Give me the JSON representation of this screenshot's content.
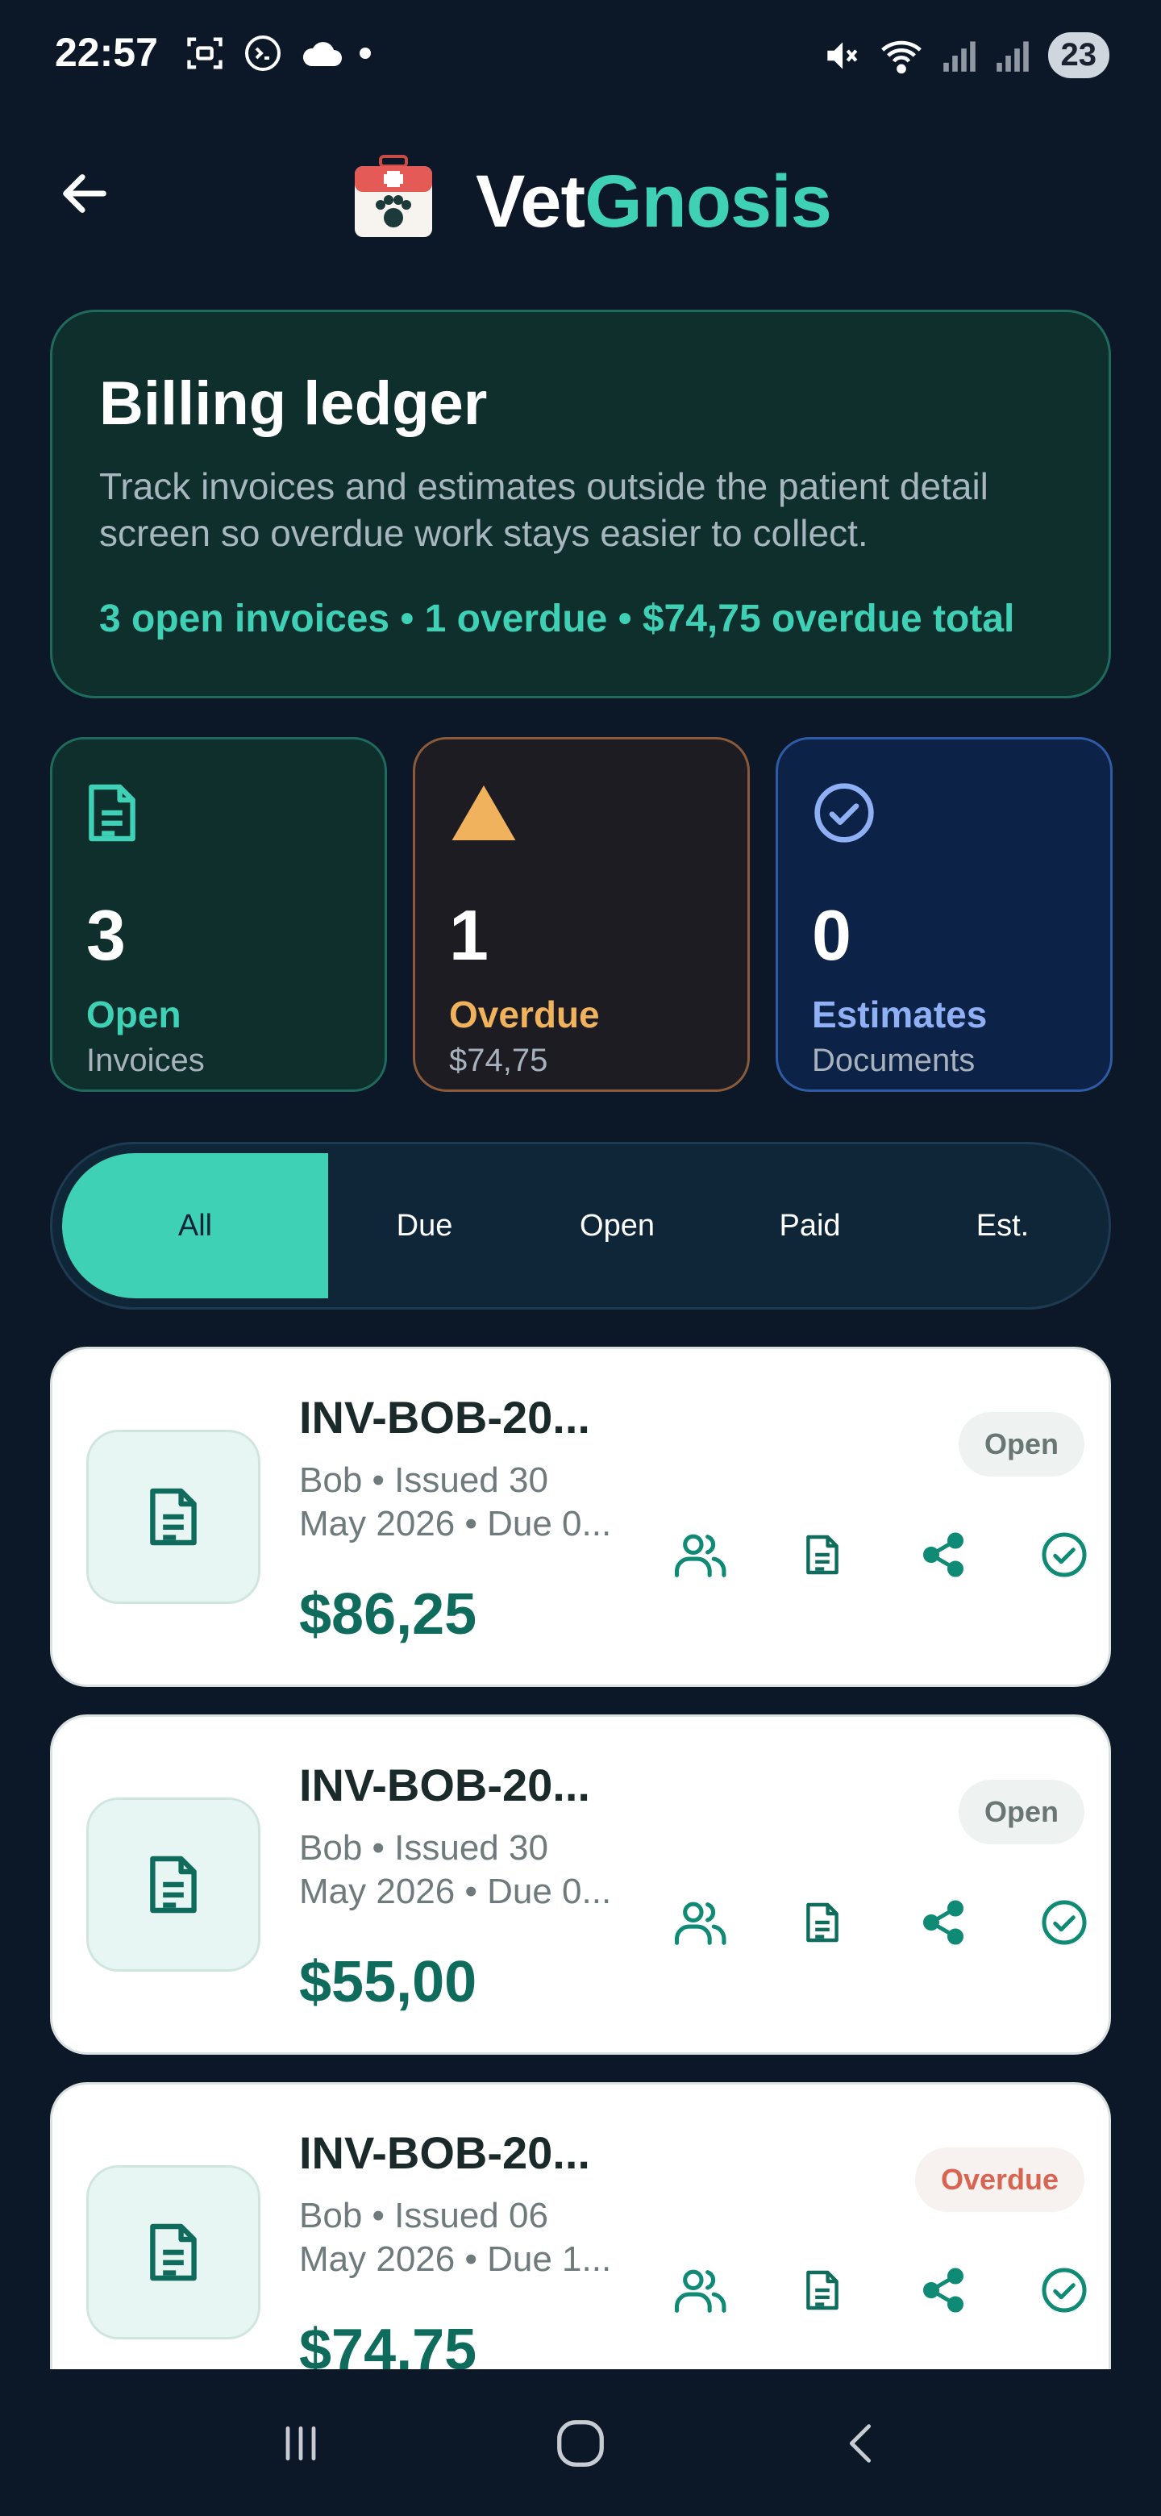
{
  "status_bar": {
    "time": "22:57",
    "battery": "23",
    "icons_left": [
      "screenshot-icon",
      "terminal-icon",
      "cloud-icon",
      "dot"
    ],
    "icons_right": [
      "mute-icon",
      "wifi-icon",
      "signal-icon",
      "signal-icon-2"
    ]
  },
  "header": {
    "brand_part1": "Vet",
    "brand_part2": "Gnosis",
    "back_icon": "arrow-left-icon",
    "logo_icon": "vet-kit-logo"
  },
  "ledger": {
    "title": "Billing ledger",
    "description": "Track invoices and estimates outside the patient detail screen so overdue work stays easier to collect.",
    "summary": "3 open invoices • 1 overdue • $74,75 overdue total"
  },
  "stats": [
    {
      "icon": "document-icon",
      "value": "3",
      "label": "Open",
      "sub": "Invoices",
      "color": "#3fd1b6"
    },
    {
      "icon": "warning-triangle-icon",
      "value": "1",
      "label": "Overdue",
      "sub": "$74,75",
      "color": "#f0b25c"
    },
    {
      "icon": "check-circle-icon",
      "value": "0",
      "label": "Estimates",
      "sub": "Documents",
      "color": "#8fb0f5"
    }
  ],
  "tabs": [
    "All",
    "Due",
    "Open",
    "Paid",
    "Est."
  ],
  "active_tab": "All",
  "invoices": [
    {
      "title": "INV-BOB-20...",
      "meta_line1": "Bob • Issued 30",
      "meta_line2": "May 2026 • Due 0...",
      "amount": "$86,25",
      "status": "Open"
    },
    {
      "title": "INV-BOB-20...",
      "meta_line1": "Bob • Issued 30",
      "meta_line2": "May 2026 • Due 0...",
      "amount": "$55,00",
      "status": "Open"
    },
    {
      "title": "INV-BOB-20...",
      "meta_line1": "Bob • Issued 06",
      "meta_line2": "May 2026 • Due 1...",
      "amount": "$74,75",
      "status": "Overdue"
    }
  ],
  "invoice_actions": [
    "people-icon",
    "document-icon",
    "share-icon",
    "check-circle-icon"
  ],
  "colors": {
    "background": "#0c1827",
    "accent": "#3fd1b6",
    "overdue": "#f0b25c",
    "estimate": "#8fb0f5",
    "amount": "#0f6b5c"
  }
}
